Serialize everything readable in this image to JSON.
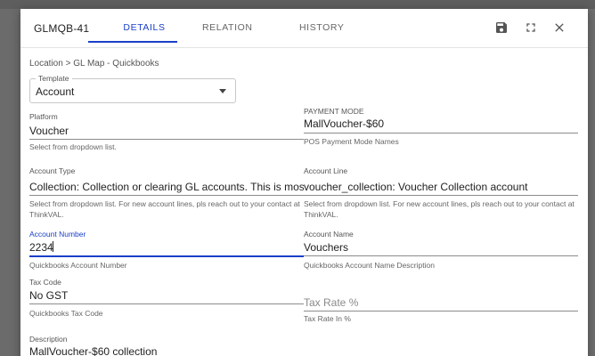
{
  "header": {
    "record_code": "GLMQB-41",
    "tabs": [
      {
        "label": "DETAILS",
        "active": true
      },
      {
        "label": "RELATION",
        "active": false
      },
      {
        "label": "HISTORY",
        "active": false
      }
    ],
    "icons": [
      "save-icon",
      "fullscreen-icon",
      "close-icon"
    ]
  },
  "breadcrumb": "Location > GL Map - Quickbooks",
  "template": {
    "label": "Template",
    "value": "Account"
  },
  "fields": {
    "platform": {
      "label": "Platform",
      "value": "Voucher",
      "help": "Select from dropdown list."
    },
    "payment_mode": {
      "label": "PAYMENT MODE",
      "value": "MallVoucher-$60",
      "help": "POS Payment Mode Names"
    },
    "account_type": {
      "label": "Account Type",
      "value": "Collection: Collection or clearing GL accounts. This is mostly by",
      "help_line1": "Select from dropdown list. For new account lines, pls reach out to your contact at",
      "help_line2": "ThinkVAL."
    },
    "account_line": {
      "label": "Account Line",
      "value": "voucher_collection: Voucher Collection account",
      "help_line1": "Select from dropdown list. For new account lines, pls reach out to your contact at",
      "help_line2": "ThinkVAL."
    },
    "account_number": {
      "label": "Account Number",
      "value": "2234",
      "help": "Quickbooks Account Number"
    },
    "account_name": {
      "label": "Account Name",
      "value": "Vouchers",
      "help": "Quickbooks Account Name Description"
    },
    "tax_code": {
      "label": "Tax Code",
      "value": "No GST",
      "help": "Quickbooks Tax Code"
    },
    "tax_rate": {
      "placeholder": "Tax Rate %",
      "help": "Tax Rate In %"
    },
    "description": {
      "label": "Description",
      "value": "MallVoucher-$60 collection"
    }
  },
  "colors": {
    "accent": "#1a3fc9",
    "text": "#222222",
    "muted": "#666666",
    "overlay": "#6b6b6b"
  }
}
